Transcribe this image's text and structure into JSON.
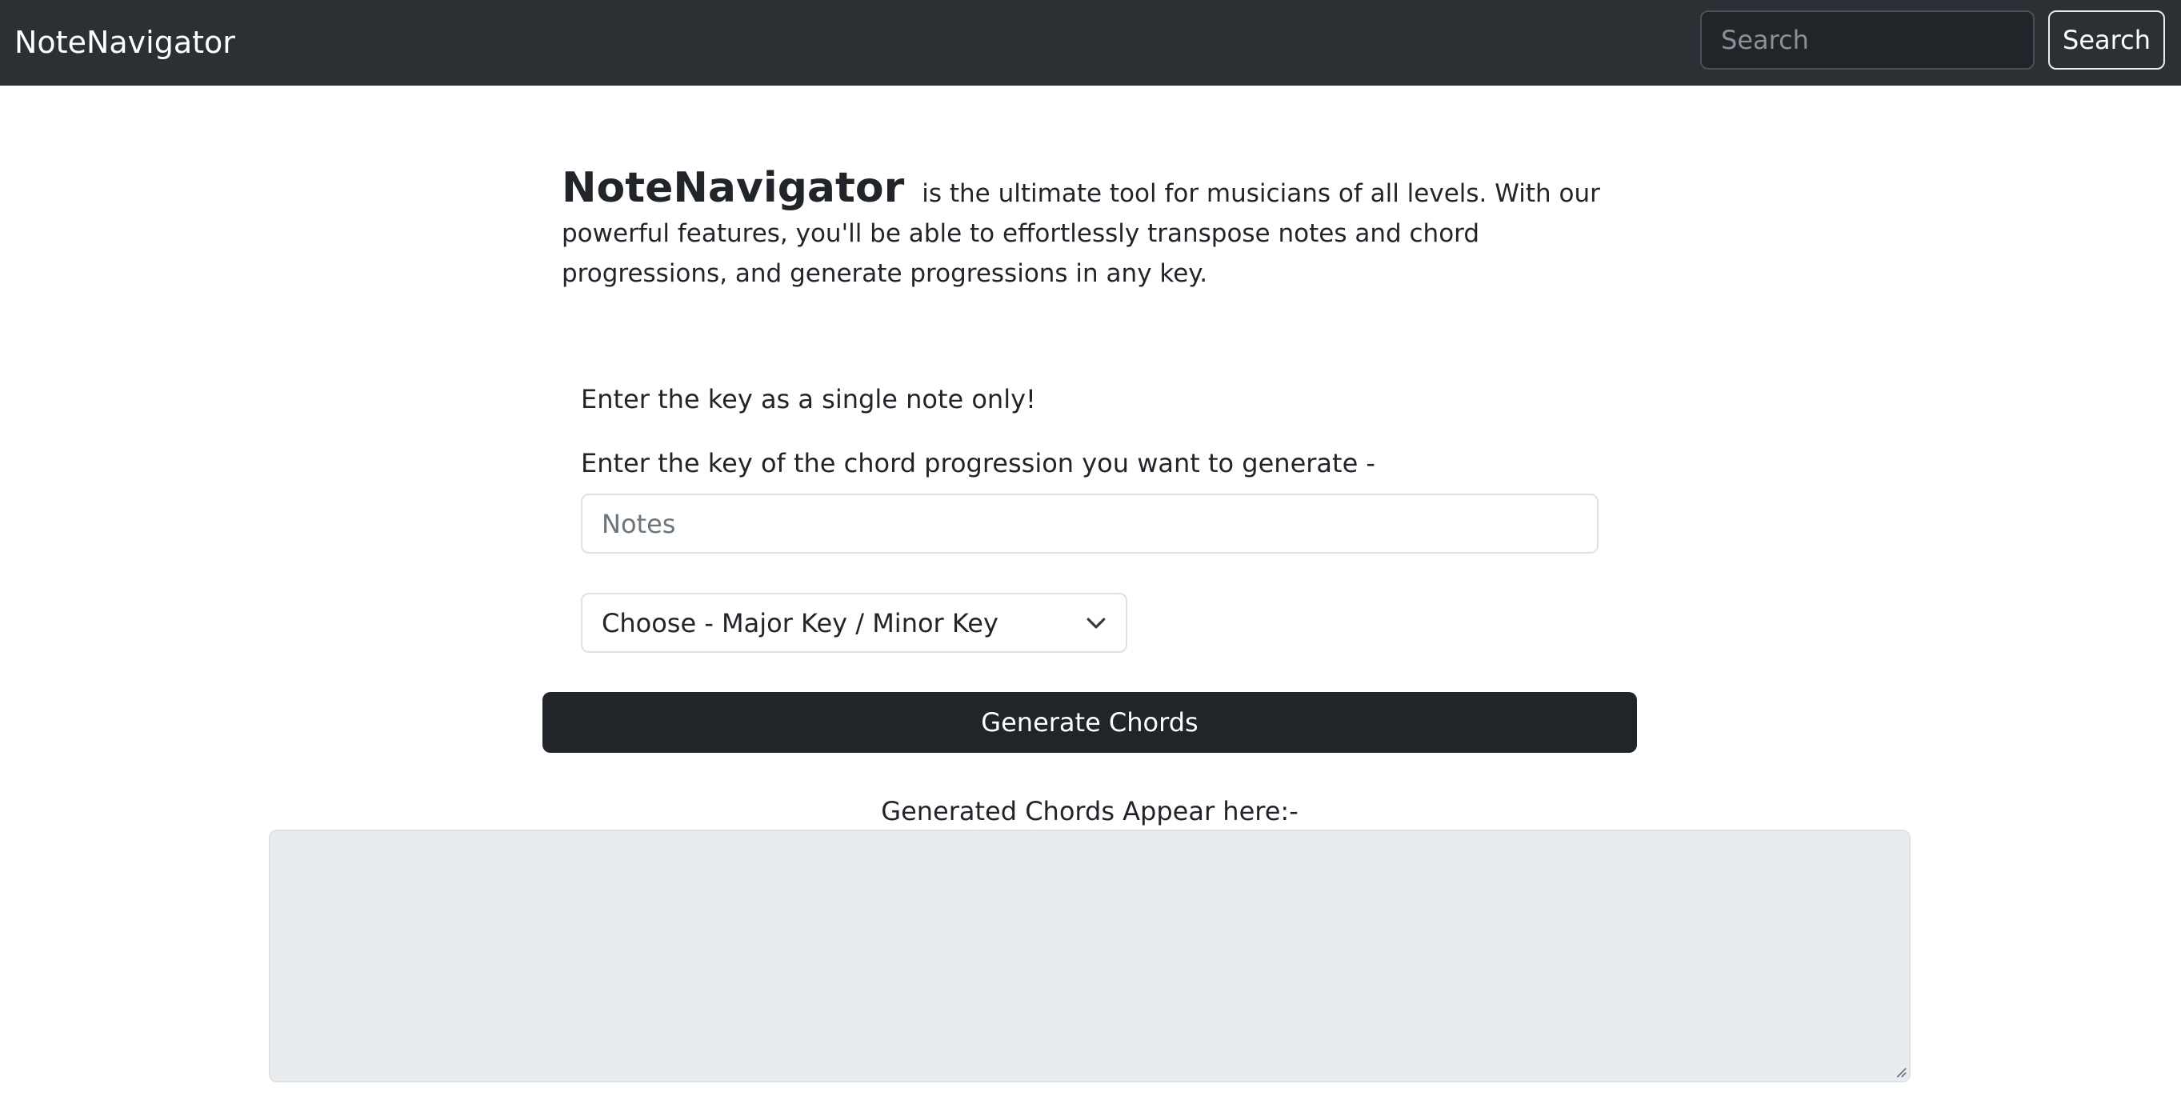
{
  "navbar": {
    "brand": "NoteNavigator",
    "search_placeholder": "Search",
    "search_button": "Search"
  },
  "intro": {
    "brand": "NoteNavigator",
    "text": "is the ultimate tool for musicians of all levels. With our powerful features, you'll be able to effortlessly transpose notes and chord progressions, and generate progressions in any key."
  },
  "form": {
    "hint": "Enter the key as a single note only!",
    "key_label": "Enter the key of the chord progression you want to generate -",
    "notes_placeholder": "Notes",
    "key_select_value": "Choose - Major Key / Minor Key",
    "generate_button": "Generate Chords"
  },
  "output": {
    "label": "Generated Chords Appear here:-",
    "value": ""
  },
  "colors": {
    "navbar_bg": "#2b3035",
    "button_dark": "#212529",
    "output_bg": "#e9ecef"
  },
  "icons": {
    "select_chevron": "chevron-down-icon",
    "textarea_resize": "resize-handle-icon"
  }
}
